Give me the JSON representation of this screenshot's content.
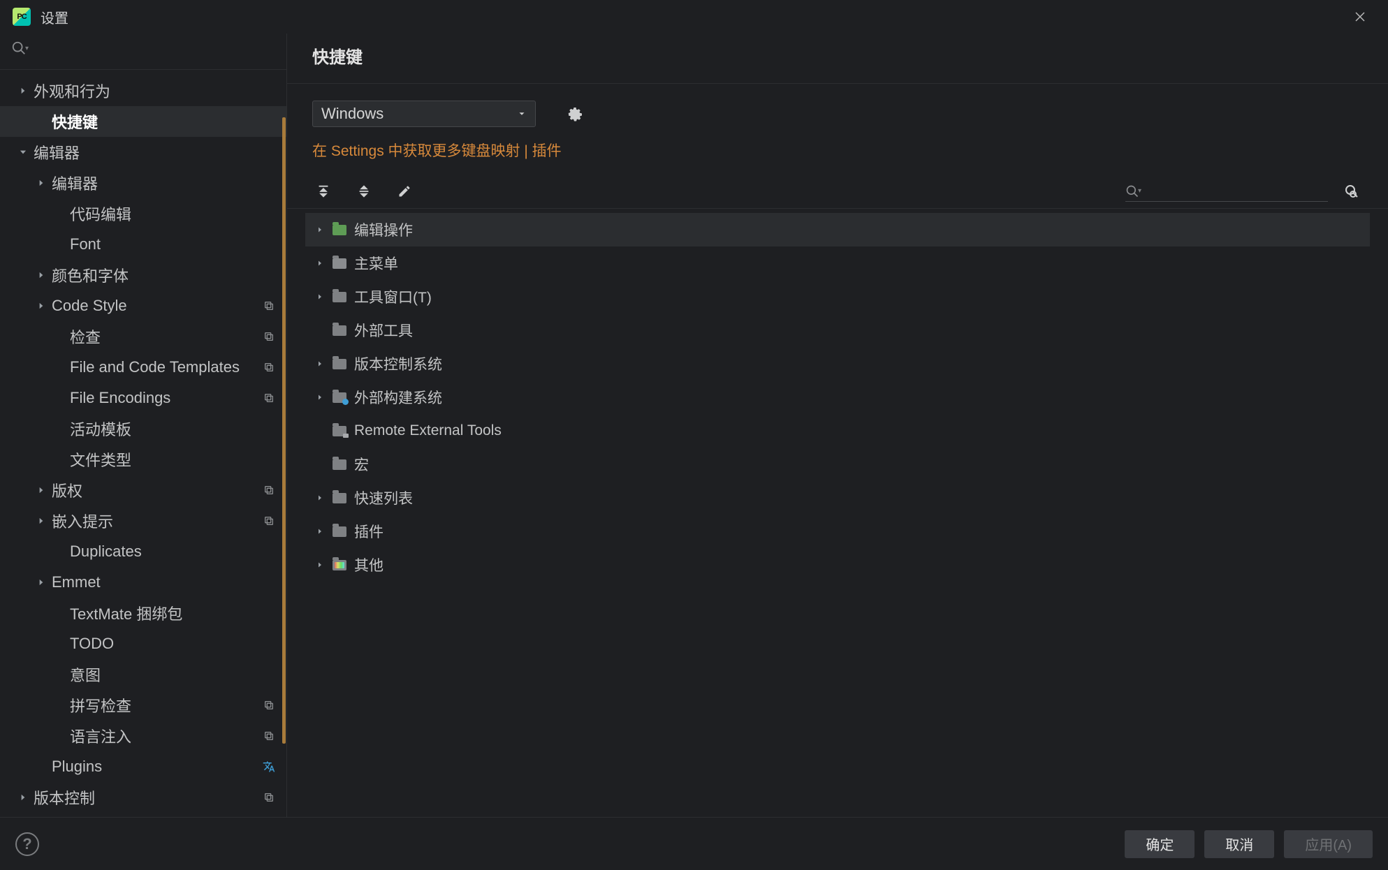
{
  "title": "设置",
  "sidebar": {
    "items": [
      {
        "label": "外观和行为",
        "lv": 0,
        "arr": "right"
      },
      {
        "label": "快捷键",
        "lv": 1,
        "sel": true
      },
      {
        "label": "编辑器",
        "lv": 0,
        "arr": "down"
      },
      {
        "label": "编辑器",
        "lv": 1,
        "arr": "right"
      },
      {
        "label": "代码编辑",
        "lv": 2
      },
      {
        "label": "Font",
        "lv": 2
      },
      {
        "label": "颜色和字体",
        "lv": 1,
        "arr": "right"
      },
      {
        "label": "Code Style",
        "lv": 1,
        "arr": "right",
        "copy": true
      },
      {
        "label": "检查",
        "lv": 2,
        "copy": true
      },
      {
        "label": "File and Code Templates",
        "lv": 2,
        "copy": true
      },
      {
        "label": "File Encodings",
        "lv": 2,
        "copy": true
      },
      {
        "label": "活动模板",
        "lv": 2
      },
      {
        "label": "文件类型",
        "lv": 2
      },
      {
        "label": "版权",
        "lv": 1,
        "arr": "right",
        "copy": true
      },
      {
        "label": "嵌入提示",
        "lv": 1,
        "arr": "right",
        "copy": true
      },
      {
        "label": "Duplicates",
        "lv": 2
      },
      {
        "label": "Emmet",
        "lv": 1,
        "arr": "right"
      },
      {
        "label": "TextMate 捆绑包",
        "lv": 2
      },
      {
        "label": "TODO",
        "lv": 2
      },
      {
        "label": "意图",
        "lv": 2
      },
      {
        "label": "拼写检查",
        "lv": 2,
        "copy": true
      },
      {
        "label": "语言注入",
        "lv": 2,
        "copy": true
      },
      {
        "label": "Plugins",
        "lv": 1,
        "trans": true
      },
      {
        "label": "版本控制",
        "lv": 0,
        "arr": "right",
        "copy": true
      }
    ]
  },
  "main": {
    "title": "快捷键",
    "combo": "Windows",
    "hint": "在 Settings 中获取更多键盘映射 | 插件",
    "tree": [
      {
        "label": "编辑操作",
        "arr": true,
        "icon": "grn",
        "sel": true
      },
      {
        "label": "主菜单",
        "arr": true,
        "icon": "menubar"
      },
      {
        "label": "工具窗口(T)",
        "arr": true,
        "icon": "folder"
      },
      {
        "label": "外部工具",
        "arr": false,
        "icon": "folder"
      },
      {
        "label": "版本控制系统",
        "arr": true,
        "icon": "folder"
      },
      {
        "label": "外部构建系统",
        "arr": true,
        "icon": "acc"
      },
      {
        "label": "Remote External Tools",
        "arr": false,
        "icon": "rem"
      },
      {
        "label": "宏",
        "arr": false,
        "icon": "folder"
      },
      {
        "label": "快速列表",
        "arr": true,
        "icon": "folder"
      },
      {
        "label": "插件",
        "arr": true,
        "icon": "folder"
      },
      {
        "label": "其他",
        "arr": true,
        "icon": "col"
      }
    ]
  },
  "footer": {
    "ok": "确定",
    "cancel": "取消",
    "apply": "应用(A)"
  }
}
